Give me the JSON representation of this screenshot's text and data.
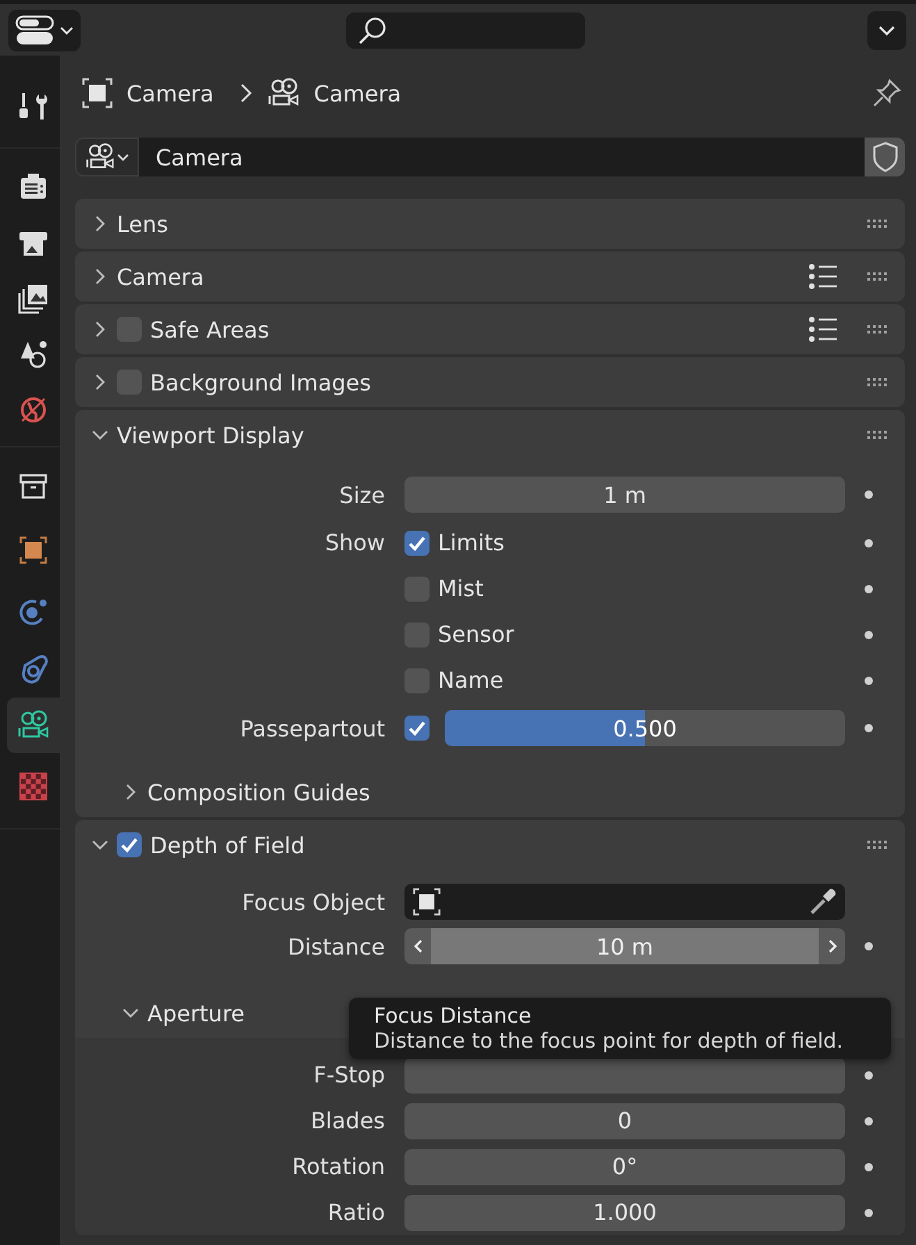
{
  "sidebar": {
    "tabs": [
      {
        "kind": "tool",
        "selected": false
      },
      {
        "kind": "render",
        "selected": false
      },
      {
        "kind": "output",
        "selected": false
      },
      {
        "kind": "view_layer",
        "selected": false
      },
      {
        "kind": "scene",
        "selected": false
      },
      {
        "kind": "world",
        "selected": false
      },
      {
        "kind": "collection",
        "selected": false
      },
      {
        "kind": "object",
        "selected": false
      },
      {
        "kind": "physics",
        "selected": false
      },
      {
        "kind": "constraints",
        "selected": false
      },
      {
        "kind": "data",
        "selected": true
      },
      {
        "kind": "texture",
        "selected": false
      }
    ]
  },
  "breadcrumb": [
    {
      "kind": "object",
      "label": "Camera"
    },
    {
      "kind": "camera",
      "label": "Camera"
    }
  ],
  "datablock": {
    "value": "Camera"
  },
  "panels": [
    {
      "title": "Lens",
      "expanded": false,
      "presets": false
    },
    {
      "title": "Camera",
      "expanded": false,
      "presets": true
    },
    {
      "title": "Safe Areas",
      "expanded": false,
      "presets": true,
      "checked": false
    },
    {
      "title": "Background Images",
      "expanded": false,
      "presets": false,
      "checked": false
    },
    {
      "title": "Viewport Display",
      "expanded": true,
      "presets": false,
      "rows": [
        {
          "kind": "number",
          "label": "Size",
          "value": "1 m"
        },
        {
          "kind": "checkbox",
          "label": "Show",
          "text": "Limits",
          "checked": true
        },
        {
          "kind": "checkbox",
          "text": "Mist",
          "checked": false
        },
        {
          "kind": "checkbox",
          "text": "Sensor",
          "checked": false
        },
        {
          "kind": "checkbox",
          "text": "Name",
          "checked": false
        },
        {
          "kind": "checkslider",
          "label": "Passepartout",
          "checked": true,
          "value": "0.500",
          "level": 0.5
        },
        {
          "kind": "subpanel",
          "title": "Composition Guides",
          "expanded": false
        }
      ]
    },
    {
      "title": "Depth of Field",
      "expanded": true,
      "presets": false,
      "checked": true,
      "rows": [
        {
          "kind": "object",
          "label": "Focus Object"
        },
        {
          "kind": "stepper",
          "label": "Distance",
          "value": "10 m"
        },
        {
          "kind": "subpanel",
          "title": "Aperture",
          "expanded": true,
          "children": [
            {
              "kind": "number",
              "label": "F-Stop"
            },
            {
              "kind": "number",
              "label": "Blades",
              "value": "0"
            },
            {
              "kind": "number",
              "label": "Rotation",
              "value": "0°"
            },
            {
              "kind": "number",
              "label": "Ratio",
              "value": "1.000"
            }
          ]
        }
      ]
    }
  ],
  "tooltip": {
    "title": "Focus Distance",
    "description": "Distance to the focus point for depth of field."
  }
}
